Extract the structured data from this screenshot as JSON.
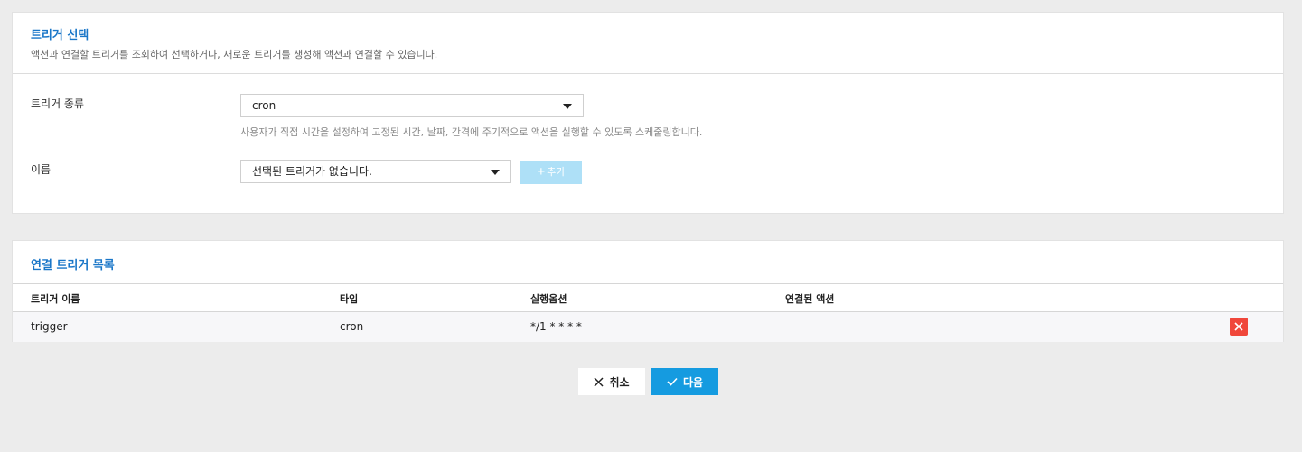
{
  "trigger_panel": {
    "title": "트리거 선택",
    "description": "액션과 연결할 트리거를 조회하여 선택하거나, 새로운 트리거를 생성해 액션과 연결할 수 있습니다.",
    "type_label": "트리거 종류",
    "type_value": "cron",
    "type_help": "사용자가 직접 시간을 설정하여 고정된 시간, 날짜, 간격에 주기적으로 액션을 실행할 수 있도록 스케줄링합니다.",
    "name_label": "이름",
    "name_value": "선택된 트리거가 없습니다.",
    "add_button": "추가"
  },
  "list_panel": {
    "title": "연결 트리거 목록",
    "columns": [
      "트리거 이름",
      "타입",
      "실행옵션",
      "연결된 액션"
    ],
    "rows": [
      {
        "name": "trigger",
        "type": "cron",
        "option": "*/1 * * * *",
        "linked_action": ""
      }
    ]
  },
  "footer": {
    "cancel": "취소",
    "next": "다음"
  },
  "colors": {
    "accent": "#159be0",
    "title": "#1976c8",
    "delete": "#f0473b",
    "add_disabled": "#aee0f7"
  }
}
